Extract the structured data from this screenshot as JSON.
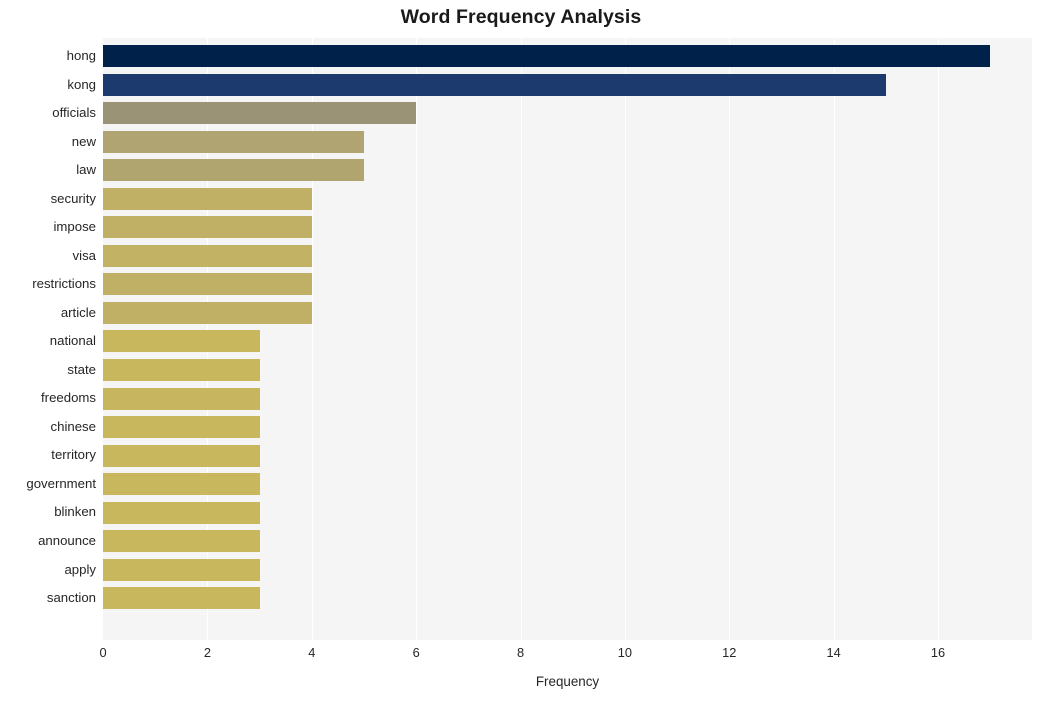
{
  "chart_data": {
    "type": "bar",
    "orientation": "horizontal",
    "title": "Word Frequency Analysis",
    "xlabel": "Frequency",
    "ylabel": "",
    "xlim": [
      0,
      17.8
    ],
    "ylim": [
      0,
      20
    ],
    "grid": true,
    "legend": null,
    "xticks": [
      0,
      2,
      4,
      6,
      8,
      10,
      12,
      14,
      16
    ],
    "xtick_labels": [
      "0",
      "2",
      "4",
      "6",
      "8",
      "10",
      "12",
      "14",
      "16"
    ],
    "categories": [
      "hong",
      "kong",
      "officials",
      "new",
      "law",
      "security",
      "impose",
      "visa",
      "restrictions",
      "article",
      "national",
      "state",
      "freedoms",
      "chinese",
      "territory",
      "government",
      "blinken",
      "announce",
      "apply",
      "sanction"
    ],
    "values": [
      17,
      15,
      6,
      5,
      5,
      4,
      4,
      4,
      4,
      4,
      3,
      3,
      3,
      3,
      3,
      3,
      3,
      3,
      3,
      3
    ],
    "bar_colors": [
      "#00214a",
      "#1c3a6e",
      "#9b9375",
      "#b0a472",
      "#b0a46f",
      "#c0b065",
      "#c0b065",
      "#c2b263",
      "#c0b065",
      "#c0b065",
      "#c9b75d",
      "#c9b75d",
      "#c7b55f",
      "#c9b75d",
      "#c9b75d",
      "#c9b75d",
      "#c9b75d",
      "#c9b75d",
      "#c9b75d",
      "#c9b75d"
    ],
    "plot_background": "#f5f5f6",
    "gridline_color": "#ffffff",
    "figure_background": "#ffffff"
  }
}
